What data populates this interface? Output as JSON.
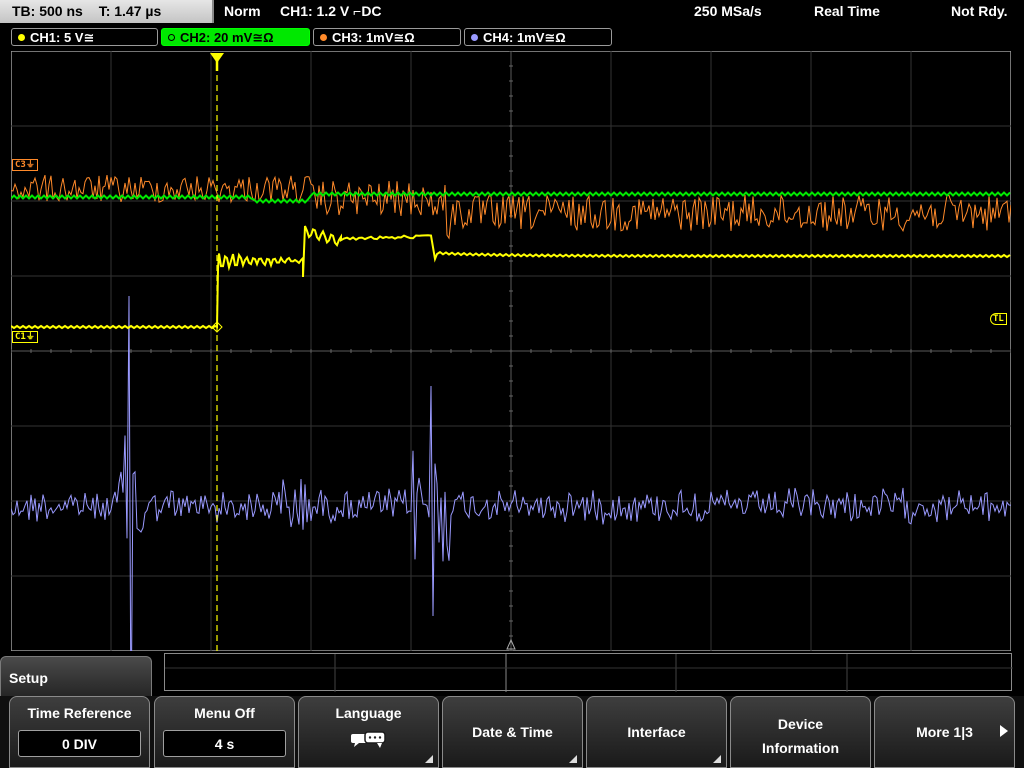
{
  "status": {
    "timebase": "TB: 500 ns",
    "trigger_time": "T: 1.47 µs",
    "acq_mode": "Norm",
    "trigger": "CH1: 1.2 V ⌐DC",
    "sample_rate": "250 MSa/s",
    "mode": "Real Time",
    "ready": "Not Rdy."
  },
  "channels": [
    {
      "label": "CH1: 5 V≅",
      "color": "#ffff00",
      "active": false
    },
    {
      "label": "CH2: 20 mV≅Ω",
      "color": "#00e800",
      "active": true
    },
    {
      "label": "CH3: 1mV≅Ω",
      "color": "#ff8a2a",
      "active": false
    },
    {
      "label": "CH4: 1mV≅Ω",
      "color": "#9a9aff",
      "active": false
    }
  ],
  "markers": {
    "c3": "C3",
    "c1": "C1",
    "tl": "TL"
  },
  "menu": {
    "title": "Setup",
    "softkeys": [
      {
        "label": "Time Reference",
        "value": "0 DIV"
      },
      {
        "label": "Menu Off",
        "value": "4 s"
      },
      {
        "label": "Language",
        "icon": "speech-bubble-icon"
      },
      {
        "label": "Date & Time"
      },
      {
        "label": "Interface"
      },
      {
        "label": "Device Information"
      },
      {
        "label": "More 1|3"
      }
    ]
  },
  "colors": {
    "ch1": "#ffff00",
    "ch2": "#00e800",
    "ch3": "#ff8a2a",
    "ch4": "#9a9aff",
    "trigger": "#ffff00"
  }
}
